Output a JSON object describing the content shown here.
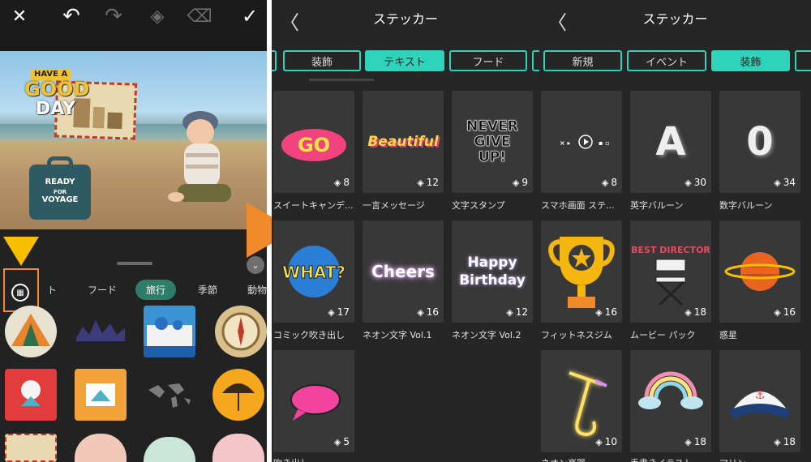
{
  "editor": {
    "toolbar": {
      "close": "✕",
      "undo": "↶",
      "redo": "↷",
      "layers": "◈",
      "eraser": "⌫",
      "done": "✓"
    },
    "photo_stickers": {
      "good_day_line1": "HAVE A",
      "good_day_line2": "GOOD",
      "good_day_line3": "DAY",
      "ready_line1": "READY",
      "ready_line2": "FOR",
      "ready_line3": "VOYAGE"
    },
    "categories": [
      {
        "label": "ト",
        "active": false
      },
      {
        "label": "フード",
        "active": false
      },
      {
        "label": "旅行",
        "active": true
      },
      {
        "label": "季節",
        "active": false
      },
      {
        "label": "動物",
        "active": false
      }
    ],
    "collapse_icon": "⌄"
  },
  "sticker_text_panel": {
    "title": "ステッカー",
    "back": "〈",
    "tabs": [
      "装飾",
      "テキスト",
      "フード"
    ],
    "active_tab": "テキスト",
    "cards": [
      {
        "label": "スイートキャンデ...",
        "count": "8",
        "art": "GO"
      },
      {
        "label": "一言メッセージ",
        "count": "12",
        "art": "Beautiful"
      },
      {
        "label": "文字スタンプ",
        "count": "9",
        "art": "NEVER GIVE UP!"
      },
      {
        "label": "コミック吹き出し",
        "count": "17",
        "art": "WHAT?"
      },
      {
        "label": "ネオン文字 Vol.1",
        "count": "16",
        "art": "Cheers"
      },
      {
        "label": "ネオン文字 Vol.2",
        "count": "12",
        "art": "Happy Birthday"
      },
      {
        "label": "吹き出し",
        "count": "5",
        "art": ""
      }
    ]
  },
  "sticker_deco_panel": {
    "title": "ステッカー",
    "back": "〈",
    "tabs": [
      "新規",
      "イベント",
      "装飾"
    ],
    "active_tab": "装飾",
    "cards": [
      {
        "label": "スマホ画面 ステ...",
        "count": "8"
      },
      {
        "label": "英字バルーン",
        "count": "30",
        "art": "A"
      },
      {
        "label": "数字バルーン",
        "count": "34",
        "art": "0"
      },
      {
        "label": "フィットネスジム",
        "count": "16"
      },
      {
        "label": "ムービー パック",
        "count": "18",
        "art": "BEST DIRECTOR"
      },
      {
        "label": "惑星",
        "count": "16"
      },
      {
        "label": "ネオン楽器",
        "count": "10"
      },
      {
        "label": "手書きイラスト",
        "count": "18"
      },
      {
        "label": "マリン",
        "count": "18"
      }
    ]
  },
  "colors": {
    "accent_teal": "#2fd3b9",
    "highlight_orange": "#f08a2a",
    "pointer_yellow": "#f6c000",
    "active_category": "#2d7d68"
  }
}
